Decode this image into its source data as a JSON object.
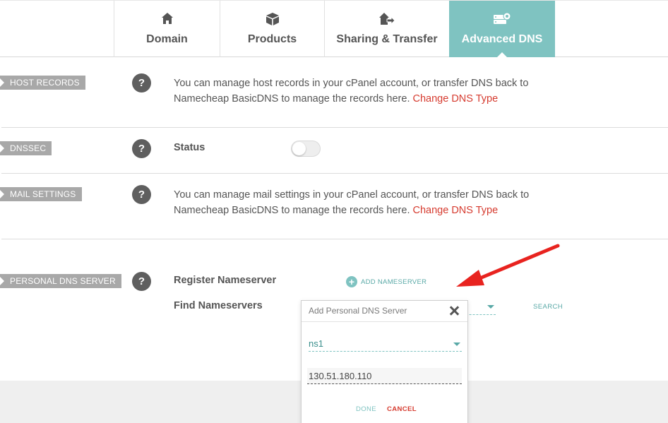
{
  "tabs": [
    {
      "label": "Domain",
      "icon": "home-icon"
    },
    {
      "label": "Products",
      "icon": "box-icon"
    },
    {
      "label": "Sharing & Transfer",
      "icon": "house-transfer-icon"
    },
    {
      "label": "Advanced DNS",
      "icon": "server-settings-icon",
      "active": true
    }
  ],
  "sections": {
    "host_records": {
      "label": "HOST RECORDS",
      "help": "?",
      "text": "You can manage host records in your cPanel account, or transfer DNS back to Namecheap BasicDNS to manage the records here. ",
      "link": "Change DNS Type"
    },
    "dnssec": {
      "label": "DNSSEC",
      "help": "?",
      "status_label": "Status",
      "status_enabled": false
    },
    "mail_settings": {
      "label": "MAIL SETTINGS",
      "help": "?",
      "text": "You can manage mail settings in your cPanel account, or transfer DNS back to Namecheap BasicDNS to manage the records here. ",
      "link": "Change DNS Type"
    },
    "personal_dns": {
      "label": "PERSONAL DNS SERVER",
      "help": "?",
      "register_label": "Register Nameserver",
      "add_button": "ADD NAMESERVER",
      "find_label": "Find Nameservers",
      "search_button": "SEARCH"
    }
  },
  "popup": {
    "title": "Add Personal DNS Server",
    "nameserver_value": "ns1",
    "ip_value": "130.51.180.110",
    "done_label": "DONE",
    "cancel_label": "CANCEL"
  },
  "colors": {
    "accent_teal": "#7fc3c1",
    "link_red": "#d63b2f",
    "annotation_arrow": "#e8231f"
  }
}
